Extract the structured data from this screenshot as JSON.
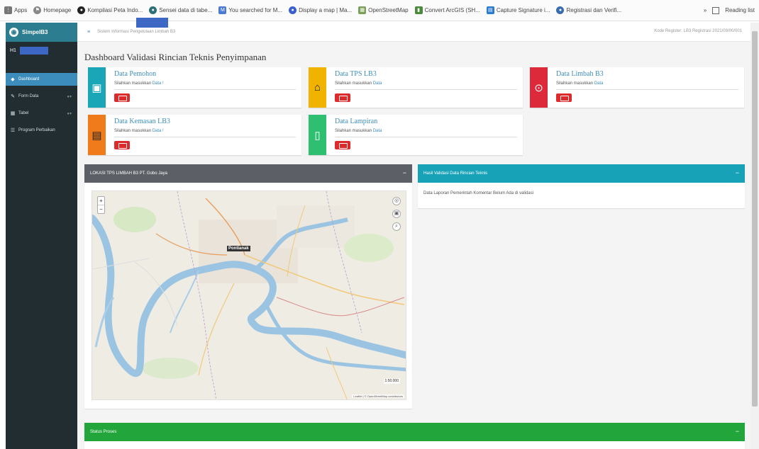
{
  "bookmarks": [
    {
      "label": "Apps",
      "icon": "apps-grid-icon"
    },
    {
      "label": "Homepage",
      "icon": "flag-icon"
    },
    {
      "label": "Kompilasi Peta Indo...",
      "icon": "globe-icon"
    },
    {
      "label": "Sensei data di tabe...",
      "icon": "globe-icon"
    },
    {
      "label": "You searched for M...",
      "icon": "search-icon"
    },
    {
      "label": "Display a map | Ma...",
      "icon": "map-icon"
    },
    {
      "label": "OpenStreetMap",
      "icon": "map-icon"
    },
    {
      "label": "Convert ArcGIS (SH...",
      "icon": "pin-icon"
    },
    {
      "label": "Capture Signature i...",
      "icon": "doc-icon"
    },
    {
      "label": "Registrasi dan Verifi...",
      "icon": "globe-icon"
    }
  ],
  "reading_list": "Reading list",
  "sidebar": {
    "brand": "SimpelB3",
    "user": "H1",
    "items": [
      {
        "label": "Dashboard",
        "icon": "dashboard-icon",
        "active": true,
        "badge": ""
      },
      {
        "label": "Form Data",
        "icon": "edit-icon",
        "active": false,
        "badge": "●▾"
      },
      {
        "label": "Tabel",
        "icon": "table-icon",
        "active": false,
        "badge": "●▾"
      },
      {
        "label": "Program Perbaikan",
        "icon": "list-icon",
        "active": false,
        "badge": ""
      }
    ]
  },
  "topnav": {
    "breadcrumb": "Sistem Informasi Pengelolaan Limbah B3",
    "right": "Kode Register: LB3 Registrasi 2021/09/00/001"
  },
  "page_title": "Dashboard Validasi Rincian Teknis Penyimpanan",
  "info_boxes": [
    {
      "title": "Data Pemohon",
      "sub": "Silahkan masukkan",
      "link": "Data !",
      "color": "#1aa6b7",
      "icon": "user-card-icon"
    },
    {
      "title": "Data TPS LB3",
      "sub": "Silahkan masukkan",
      "link": "Data",
      "color": "#f0b400",
      "icon": "home-icon"
    },
    {
      "title": "Data Limbah B3",
      "sub": "Silahkan masukkan",
      "link": "Data",
      "color": "#dd2a3a",
      "icon": "binoculars-icon"
    },
    {
      "title": "Data Kemasan LB3",
      "sub": "Silahkan masukkan",
      "link": "Data !",
      "color": "#f07b1a",
      "icon": "archive-icon"
    },
    {
      "title": "Data Lampiran",
      "sub": "Silahkan masukkan",
      "link": "Data",
      "color": "#2fbf71",
      "icon": "file-icon"
    }
  ],
  "map_panel": {
    "title": "LOKASI TPS LIMBAH B3 PT. Gobo Jaya",
    "city": "Pontianak",
    "scale": "1:50.000",
    "attribution": "Leaflet | © OpenStreetMap contributors"
  },
  "validation_panel": {
    "title": "Hasil Validasi Data Rincian Teknis",
    "body": "Data Laporan Pemerintah Komentar Belum Ada di validasi"
  },
  "status_panel": {
    "title": "Status Proses"
  },
  "colors": {
    "sidebar": "#222d32",
    "brand": "#2c7d8f",
    "active": "#3c8dbc",
    "map_panel_head": "#5c6066",
    "validation_head": "#17a2b8",
    "status_head": "#22a63b",
    "button_red": "#dd2a2a"
  }
}
